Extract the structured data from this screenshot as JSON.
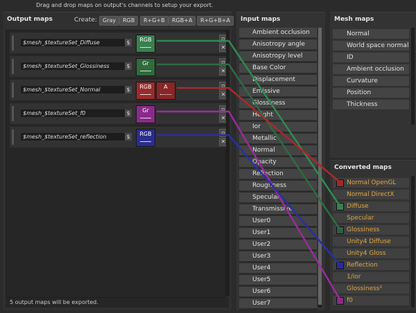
{
  "hint": "Drag and drop maps on output's channels to setup your export.",
  "output_maps": {
    "title": "Output maps",
    "create_label": "Create:",
    "create_buttons": [
      "Gray",
      "RGB",
      "R+G+B",
      "RGB+A",
      "R+G+B+A"
    ],
    "rows": [
      {
        "name": "$mesh_$textureSet_Diffuse",
        "dollar": "$",
        "channels": [
          {
            "label": "RGB",
            "color": "#3a7f4e"
          }
        ]
      },
      {
        "name": "$mesh_$textureSet_Glossiness",
        "dollar": "$",
        "channels": [
          {
            "label": "Gr",
            "color": "#2f6b3d"
          }
        ]
      },
      {
        "name": "$mesh_$textureSet_Normal",
        "dollar": "$",
        "channels": [
          {
            "label": "RGB",
            "color": "#9b2b2b"
          },
          {
            "label": "A",
            "color": "#8a2626"
          }
        ]
      },
      {
        "name": "$mesh_$textureSet_f0",
        "dollar": "$",
        "channels": [
          {
            "label": "Gr",
            "color": "#8a2a8a"
          }
        ]
      },
      {
        "name": "$mesh_$textureSet_reflection",
        "dollar": "$",
        "channels": [
          {
            "label": "RGB",
            "color": "#2a2d8c"
          }
        ]
      }
    ],
    "footer": "5 output maps will be exported."
  },
  "input_maps": {
    "title": "Input maps",
    "items": [
      "Ambient occlusion",
      "Anisotropy angle",
      "Anisotropy level",
      "Base Color",
      "Displacement",
      "Emissive",
      "Glossiness",
      "Height",
      "Ior",
      "Metallic",
      "Normal",
      "Opacity",
      "Reflection",
      "Roughness",
      "Specular",
      "Transmissive",
      "User0",
      "User1",
      "User2",
      "User3",
      "User4",
      "User5",
      "User6",
      "User7"
    ]
  },
  "mesh_maps": {
    "title": "Mesh maps",
    "items": [
      "Normal",
      "World space normal",
      "ID",
      "Ambient occlusion",
      "Curvature",
      "Position",
      "Thickness"
    ]
  },
  "converted_maps": {
    "title": "Converted maps",
    "items": [
      {
        "label": "Normal OpenGL",
        "swatch": "#9b2b2b"
      },
      {
        "label": "Normal DirectX",
        "swatch": ""
      },
      {
        "label": "Diffuse",
        "swatch": "#3a7f4e"
      },
      {
        "label": "Specular",
        "swatch": ""
      },
      {
        "label": "Glossiness",
        "swatch": "#2f5d44"
      },
      {
        "label": "Unity4 Diffuse",
        "swatch": ""
      },
      {
        "label": "Unity4 Gloss",
        "swatch": ""
      },
      {
        "label": "Reflection",
        "swatch": "#2a2d8c"
      },
      {
        "label": "1/ior",
        "swatch": ""
      },
      {
        "label": "Glossiness²",
        "swatch": ""
      },
      {
        "label": "f0",
        "swatch": "#8a2a8a"
      }
    ]
  },
  "icons": {
    "duplicate": "duplicate-icon",
    "delete": "close-icon"
  },
  "colors": {
    "diffuse_link": "#2f8a52",
    "glossiness_link": "#2c6b46",
    "normal_link": "#a82a2a",
    "f0_link": "#9a2c9a",
    "reflection_link": "#2b2fa0"
  }
}
